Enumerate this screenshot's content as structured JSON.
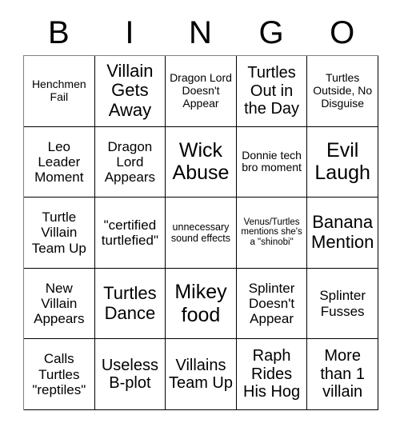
{
  "card": {
    "type": "bingo-card",
    "columns": 5,
    "rows": 5,
    "header": {
      "letters": [
        "B",
        "I",
        "N",
        "G",
        "O"
      ]
    },
    "colors": {
      "background": "#ffffff",
      "text": "#000000",
      "cell_border": "#000000",
      "outer_border": "#808080"
    },
    "rows_data": [
      {
        "cells": [
          {
            "text": "Henchmen Fail",
            "size": "sm"
          },
          {
            "text": "Villain Gets Away",
            "size": "xl"
          },
          {
            "text": "Dragon Lord Doesn't Appear",
            "size": "sm"
          },
          {
            "text": "Turtles Out in the Day",
            "size": "lg"
          },
          {
            "text": "Turtles Outside, No Disguise",
            "size": "sm"
          }
        ]
      },
      {
        "cells": [
          {
            "text": "Leo Leader Moment",
            "size": "md"
          },
          {
            "text": "Dragon Lord Appears",
            "size": "md"
          },
          {
            "text": "Wick Abuse",
            "size": "xxl"
          },
          {
            "text": "Donnie tech bro moment",
            "size": "sm"
          },
          {
            "text": "Evil Laugh",
            "size": "xxl"
          }
        ]
      },
      {
        "cells": [
          {
            "text": "Turtle Villain Team Up",
            "size": "md"
          },
          {
            "text": "\"certified turtlefied\"",
            "size": "md"
          },
          {
            "text": "unnecessary sound effects",
            "size": "xs"
          },
          {
            "text": "Venus/Turtles mentions she's a \"shinobi\"",
            "size": "xxs"
          },
          {
            "text": "Banana Mention",
            "size": "xl"
          }
        ]
      },
      {
        "cells": [
          {
            "text": "New Villain Appears",
            "size": "md"
          },
          {
            "text": "Turtles Dance",
            "size": "xl"
          },
          {
            "text": "Mikey food",
            "size": "xxl"
          },
          {
            "text": "Splinter Doesn't Appear",
            "size": "md"
          },
          {
            "text": "Splinter Fusses",
            "size": "md"
          }
        ]
      },
      {
        "cells": [
          {
            "text": "Calls Turtles \"reptiles\"",
            "size": "md"
          },
          {
            "text": "Useless B-plot",
            "size": "lg"
          },
          {
            "text": "Villains Team Up",
            "size": "lg"
          },
          {
            "text": "Raph Rides His Hog",
            "size": "lg"
          },
          {
            "text": "More than 1 villain",
            "size": "lg"
          }
        ]
      }
    ]
  }
}
